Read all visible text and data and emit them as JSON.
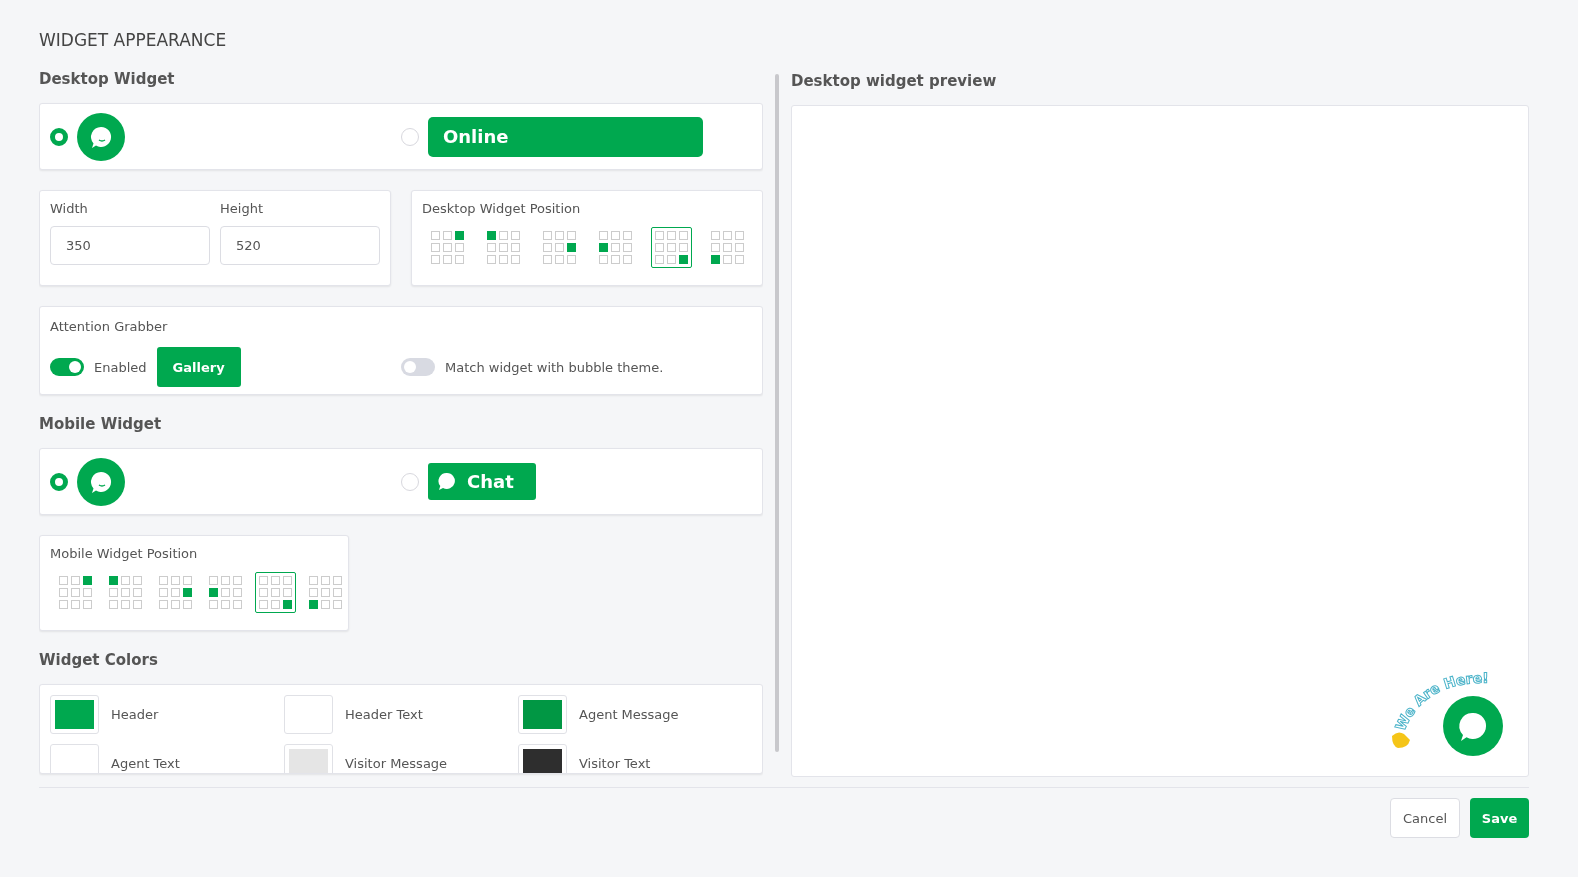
{
  "title": "WIDGET APPEARANCE",
  "desktop_widget": {
    "heading": "Desktop Widget",
    "options": [
      {
        "kind": "bubble",
        "selected": true
      },
      {
        "kind": "bar",
        "label": "Online",
        "selected": false
      }
    ],
    "size": {
      "width_label": "Width",
      "width_value": "350",
      "height_label": "Height",
      "height_value": "520"
    },
    "position": {
      "label": "Desktop Widget Position",
      "options": [
        {
          "kind": "top-right",
          "selected": false
        },
        {
          "kind": "top-left",
          "selected": false
        },
        {
          "kind": "middle-right",
          "selected": false
        },
        {
          "kind": "middle-left",
          "selected": false
        },
        {
          "kind": "bottom-right",
          "selected": true
        },
        {
          "kind": "bottom-left",
          "selected": false
        }
      ]
    },
    "attention_grabber": {
      "label": "Attention Grabber",
      "enabled_label": "Enabled",
      "on": true,
      "gallery_button": "Gallery",
      "match_label": "Match widget with bubble theme.",
      "match_on": false
    }
  },
  "mobile_widget": {
    "heading": "Mobile Widget",
    "options": [
      {
        "kind": "bubble",
        "selected": true
      },
      {
        "kind": "tab",
        "label": "Chat",
        "selected": false
      }
    ],
    "position": {
      "label": "Mobile Widget Position",
      "options": [
        {
          "kind": "top-right",
          "selected": false
        },
        {
          "kind": "top-left",
          "selected": false
        },
        {
          "kind": "middle-right",
          "selected": false
        },
        {
          "kind": "middle-left",
          "selected": false
        },
        {
          "kind": "bottom-right",
          "selected": true
        },
        {
          "kind": "bottom-left",
          "selected": false
        }
      ]
    }
  },
  "widget_colors": {
    "heading": "Widget Colors",
    "items": [
      {
        "label": "Header",
        "color": "#00a84f"
      },
      {
        "label": "Header Text",
        "color": "#ffffff"
      },
      {
        "label": "Agent Message",
        "color": "#019744"
      },
      {
        "label": "Agent Text",
        "color": "#ffffff"
      },
      {
        "label": "Visitor Message",
        "color": "#e5e5e5"
      },
      {
        "label": "Visitor Text",
        "color": "#2e2e2e"
      }
    ]
  },
  "preview": {
    "heading": "Desktop widget preview",
    "grabber_text": "We Are Here!"
  },
  "buttons": {
    "cancel": "Cancel",
    "save": "Save"
  }
}
